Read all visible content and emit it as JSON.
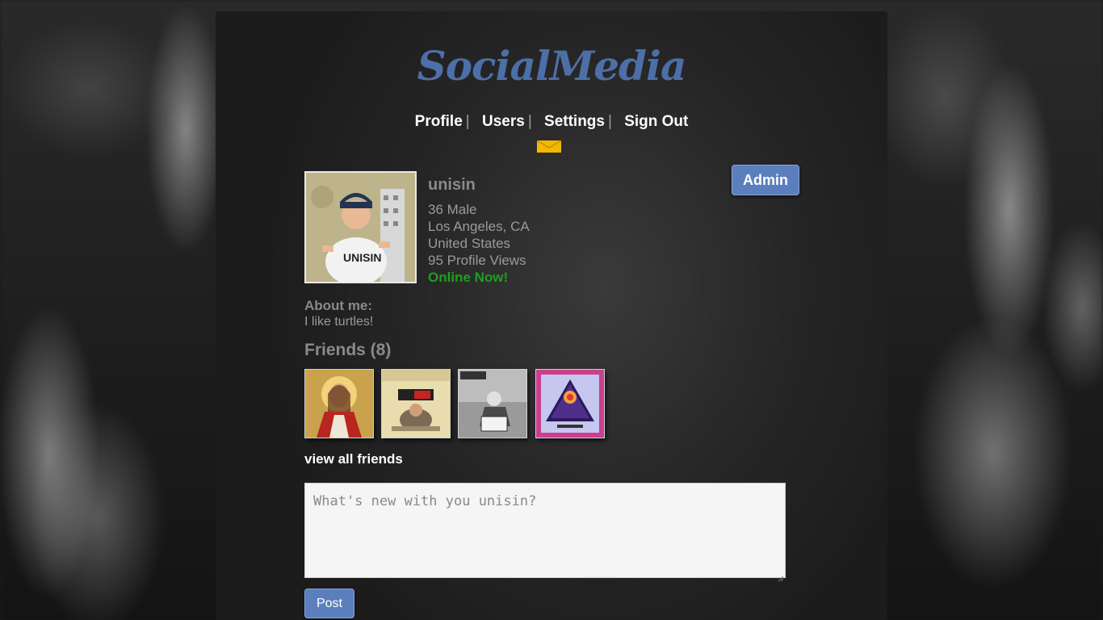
{
  "app": {
    "logo_text": "SocialMedia",
    "brand_color": "#4d6fa8"
  },
  "nav": {
    "items": [
      {
        "label": "Profile"
      },
      {
        "label": "Users"
      },
      {
        "label": "Settings"
      },
      {
        "label": "Sign Out"
      }
    ],
    "separator": "|",
    "mail_icon": "envelope-icon"
  },
  "admin_button": {
    "label": "Admin",
    "color": "#5b7fbc"
  },
  "profile": {
    "username": "unisin",
    "age_gender": "36 Male",
    "city": "Los Angeles, CA",
    "country": "United States",
    "views": "95 Profile Views",
    "status": "Online Now!",
    "status_color": "#1f9e1f",
    "about_heading": "About me:",
    "about_text": "I like turtles!"
  },
  "friends": {
    "heading": "Friends (8)",
    "thumbnails": [
      "friend-1",
      "friend-2",
      "friend-3",
      "friend-4"
    ],
    "view_all": "view all friends"
  },
  "composer": {
    "placeholder": "What's new with you unisin?",
    "value": "",
    "post_label": "Post"
  }
}
